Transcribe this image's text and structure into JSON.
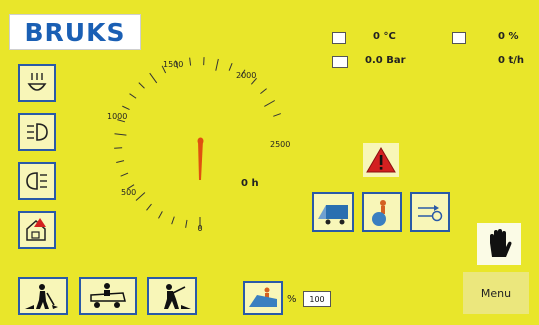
{
  "brand": {
    "logo_text": "BRUKS"
  },
  "status": {
    "temperature": "0 °C",
    "fuel": "0 %",
    "pressure": "0.0 Bar",
    "hours": "0 t/h"
  },
  "gauge": {
    "ticks": [
      "0",
      "500",
      "1000",
      "1500",
      "2000",
      "2500"
    ],
    "center_reading": "0 h"
  },
  "controls": {
    "percent_sign": "%",
    "percent_value": "100",
    "menu_label": "Menu"
  },
  "colors": {
    "background": "#e9e62a",
    "button_border": "#2a5aa7",
    "needle": "#e05010",
    "warning": "#d32020"
  }
}
